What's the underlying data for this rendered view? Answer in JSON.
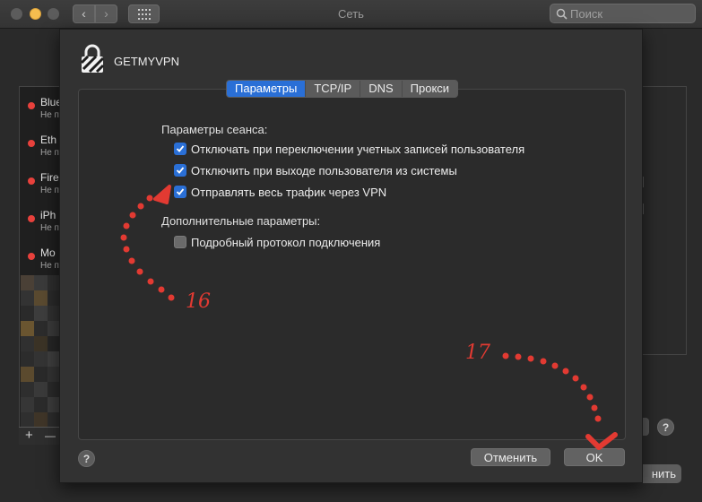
{
  "window": {
    "title": "Сеть"
  },
  "search": {
    "placeholder": "Поиск"
  },
  "background": {
    "services": [
      {
        "name": "Blue",
        "status": "Не п"
      },
      {
        "name": "Eth",
        "status": "Не п"
      },
      {
        "name": "Fire",
        "status": "Не п"
      },
      {
        "name": "iPh",
        "status": "Не п"
      },
      {
        "name": "Mo",
        "status": "Не п"
      }
    ],
    "add_label": "+",
    "remove_label": "—",
    "help_label": "?",
    "apply_label": "нить"
  },
  "sheet": {
    "vpn_name": "GETMYVPN",
    "tabs": [
      {
        "label": "Параметры",
        "active": true
      },
      {
        "label": "TCP/IP",
        "active": false
      },
      {
        "label": "DNS",
        "active": false
      },
      {
        "label": "Прокси",
        "active": false
      }
    ],
    "session_header": "Параметры сеанса:",
    "session_options": [
      {
        "label": "Отключать при переключении учетных записей пользователя",
        "checked": true
      },
      {
        "label": "Отключить при выходе пользователя из системы",
        "checked": true
      },
      {
        "label": "Отправлять весь трафик через VPN",
        "checked": true
      }
    ],
    "advanced_header": "Дополнительные параметры:",
    "advanced_options": [
      {
        "label": "Подробный протокол подключения",
        "checked": false
      }
    ],
    "help_label": "?",
    "cancel_label": "Отменить",
    "ok_label": "OK"
  },
  "annotations": {
    "step_a": "16",
    "step_b": "17"
  },
  "colors": {
    "accent": "#2a6fd6",
    "annotation": "#e23a32",
    "status_dot": "#e8413c"
  }
}
